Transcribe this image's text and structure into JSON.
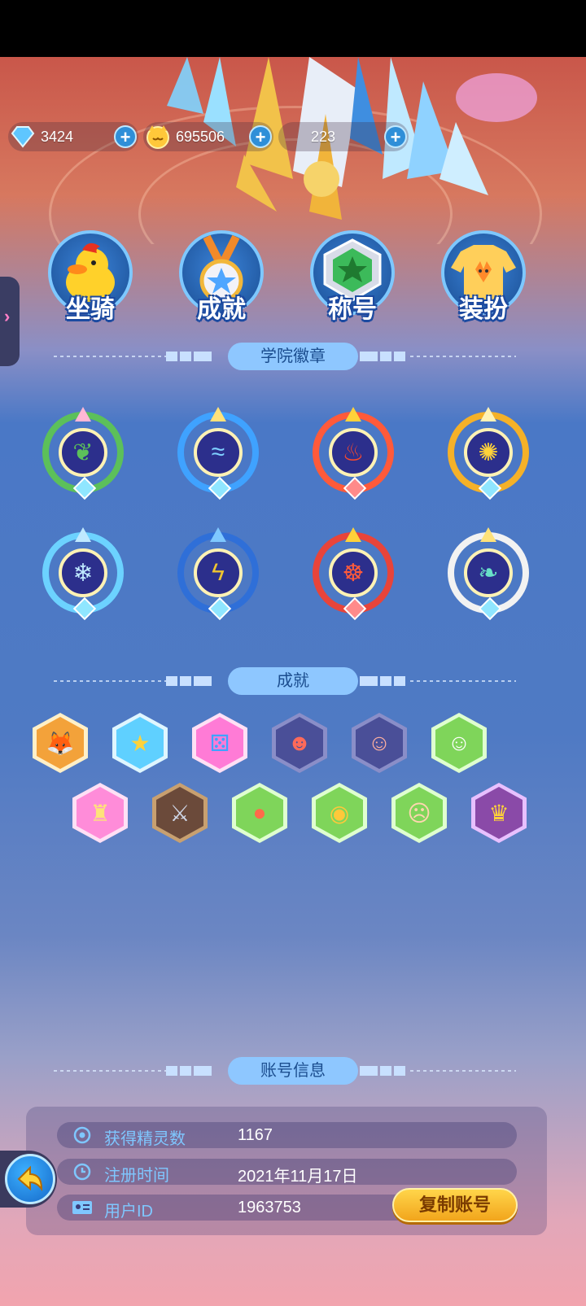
{
  "currencies": [
    {
      "name": "diamond",
      "icon": "blue-diamond-icon",
      "value": "3424"
    },
    {
      "name": "coin",
      "icon": "cat-coin-icon",
      "value": "695506"
    },
    {
      "name": "third",
      "icon": "crystal-icon",
      "value": "223"
    }
  ],
  "categories": [
    {
      "label": "坐骑",
      "icon": "duck-mount-icon"
    },
    {
      "label": "成就",
      "icon": "medal-icon"
    },
    {
      "label": "称号",
      "icon": "title-star-icon"
    },
    {
      "label": "装扮",
      "icon": "fox-sweater-icon"
    }
  ],
  "sections": {
    "badges_title": "学院徽章",
    "achievements_title": "成就",
    "account_title": "账号信息"
  },
  "badges": [
    {
      "element": "leaf",
      "color": "#5cc05a"
    },
    {
      "element": "wave",
      "color": "#3fa2ff"
    },
    {
      "element": "fire",
      "color": "#ff5a3a"
    },
    {
      "element": "sun",
      "color": "#f5b128"
    },
    {
      "element": "snow",
      "color": "#6cd2ff"
    },
    {
      "element": "lightning",
      "color": "#f0c430"
    },
    {
      "element": "dragon",
      "color": "#e8443a"
    },
    {
      "element": "wing",
      "color": "#69e0c8"
    }
  ],
  "achievements": [
    {
      "icon": "fox-icon",
      "color": "#f3a23a"
    },
    {
      "icon": "star-wings-icon",
      "color": "#5fd0ff"
    },
    {
      "icon": "dice-icon",
      "color": "#ff7bd6"
    },
    {
      "icon": "monster-icon",
      "color": "#5a5ea8"
    },
    {
      "icon": "penguin-icon",
      "color": "#5a5ea8"
    },
    {
      "icon": "rabbit-icon",
      "color": "#7fd55a"
    },
    {
      "icon": "castle-icon",
      "color": "#ff8cd9"
    },
    {
      "icon": "sword-icon",
      "color": "#6b4a3a"
    },
    {
      "icon": "fruits-icon",
      "color": "#7fd55a"
    },
    {
      "icon": "coin-icon",
      "color": "#7fd55a"
    },
    {
      "icon": "angry-face-icon",
      "color": "#7fd55a"
    },
    {
      "icon": "king-icon",
      "color": "#8a4aa8"
    }
  ],
  "account": {
    "rows": [
      {
        "label": "获得精灵数",
        "value": "1167",
        "icon": "spirit-eye-icon"
      },
      {
        "label": "注册时间",
        "value": "2021年11月17日",
        "icon": "clock-icon"
      },
      {
        "label": "用户ID",
        "value": "1963753",
        "icon": "id-card-icon"
      }
    ],
    "copy_button": "复制账号"
  }
}
